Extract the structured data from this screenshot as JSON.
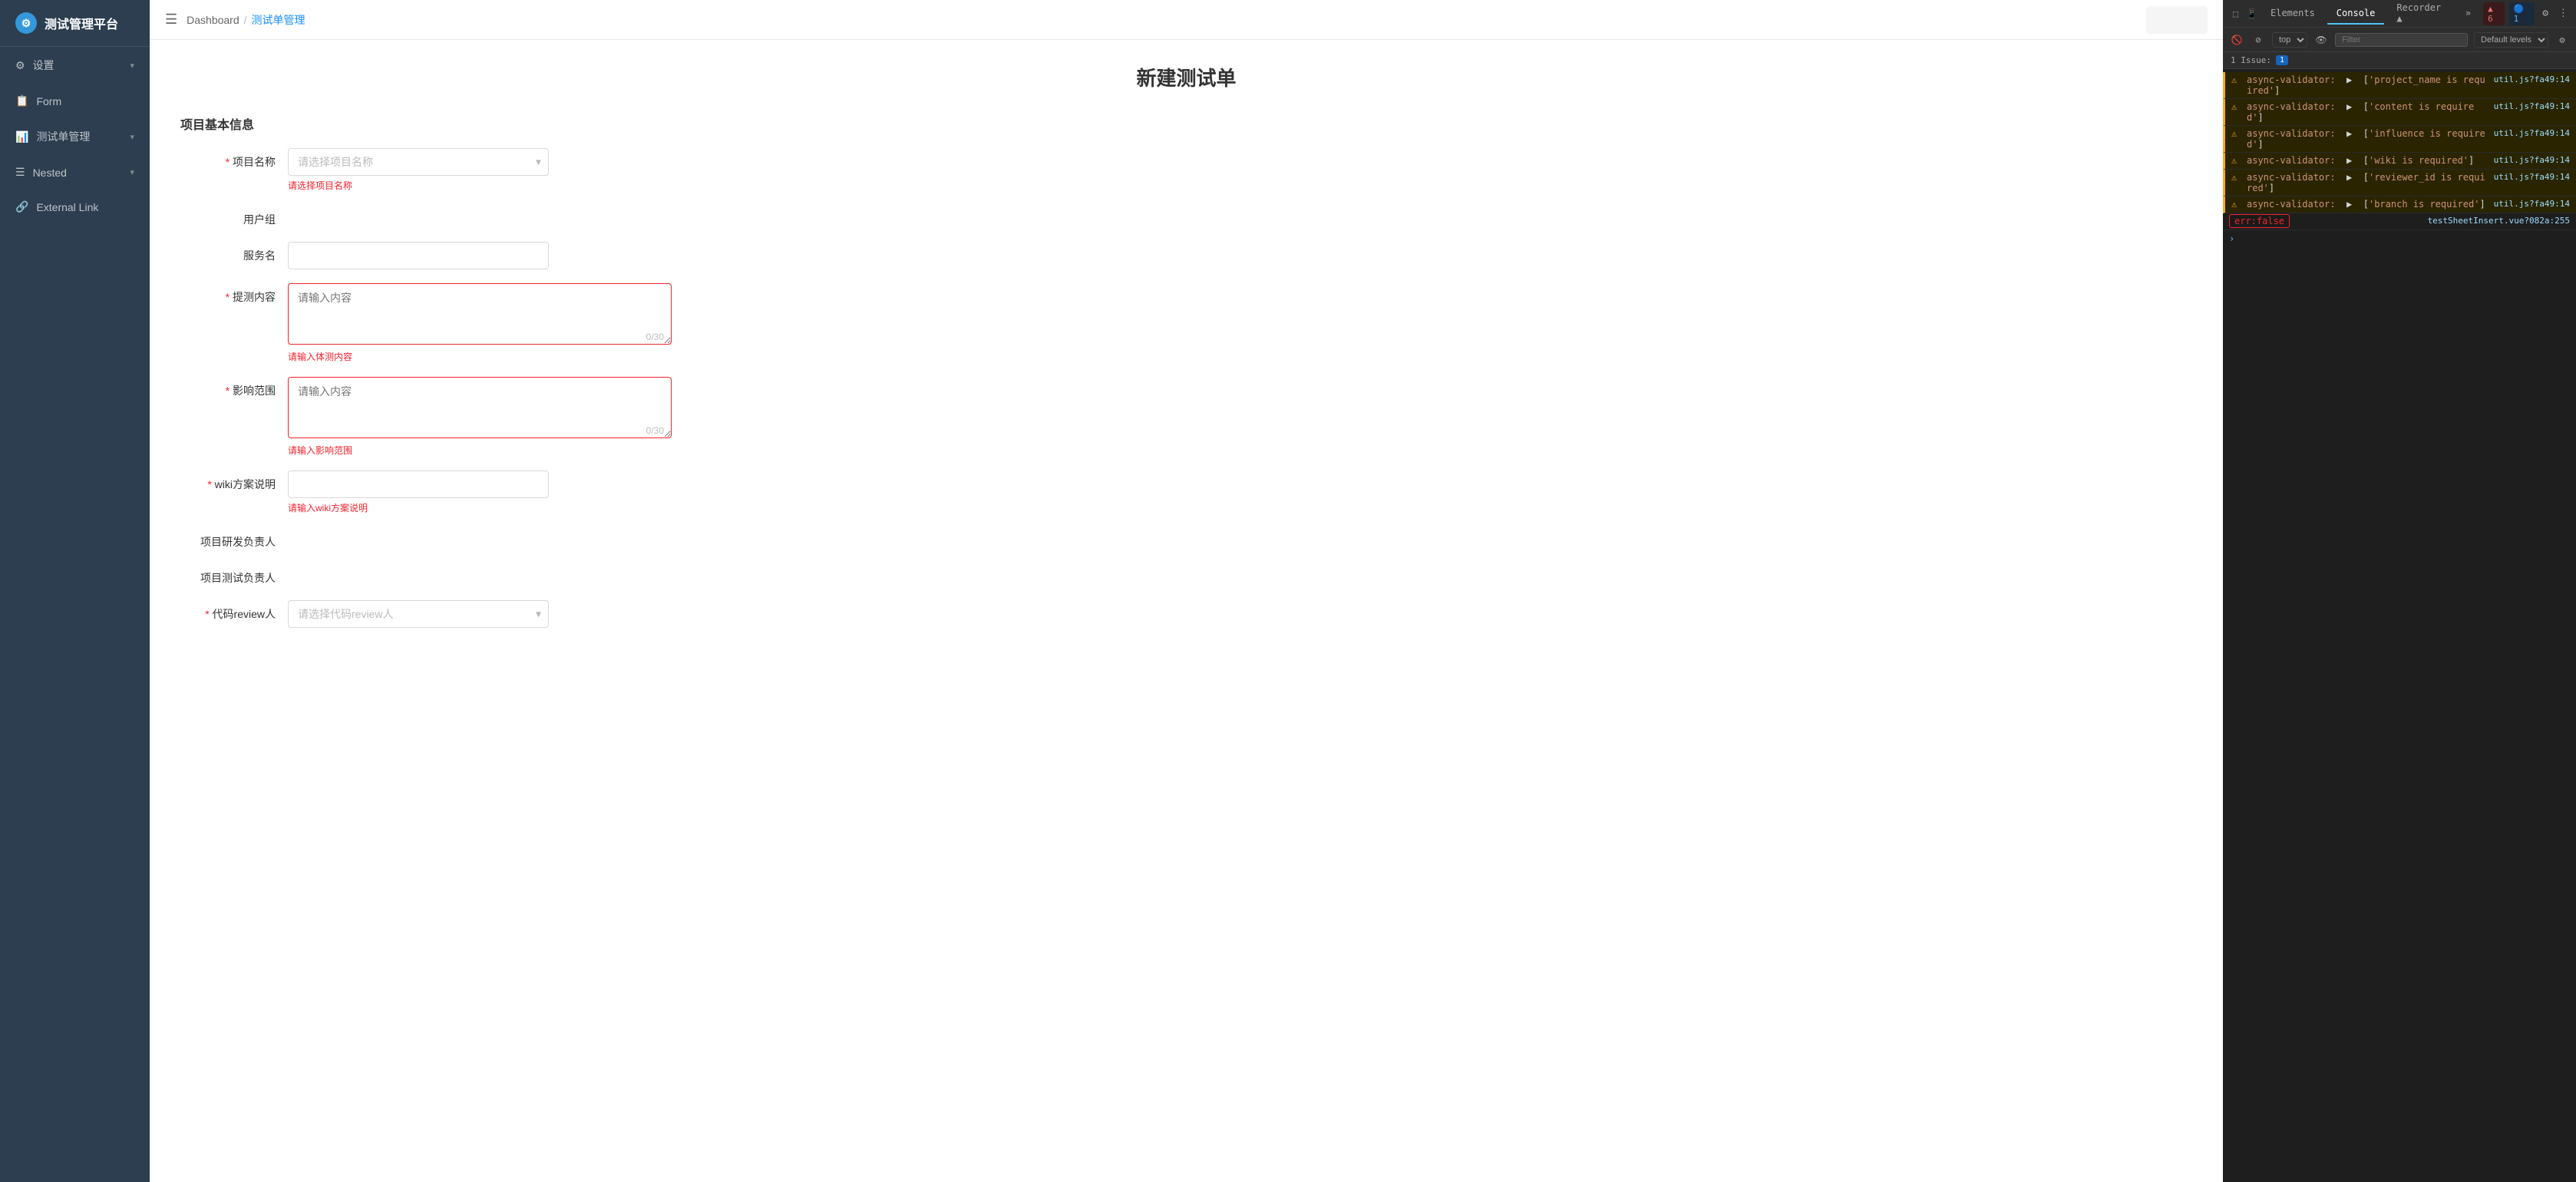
{
  "sidebar": {
    "logo": {
      "icon": "⚙",
      "title": "测试管理平台"
    },
    "items": [
      {
        "id": "settings",
        "icon": "⚙",
        "label": "设置",
        "hasChevron": true
      },
      {
        "id": "form",
        "icon": "📋",
        "label": "Form",
        "hasChevron": false
      },
      {
        "id": "test-manage",
        "icon": "📊",
        "label": "测试单管理",
        "hasChevron": true
      },
      {
        "id": "nested",
        "icon": "☰",
        "label": "Nested",
        "hasChevron": true
      },
      {
        "id": "external-link",
        "icon": "🔗",
        "label": "External Link",
        "hasChevron": false
      }
    ]
  },
  "topbar": {
    "breadcrumb": {
      "home": "Dashboard",
      "separator": "/",
      "current": "测试单管理"
    }
  },
  "form": {
    "page_title": "新建测试单",
    "section_title": "项目基本信息",
    "fields": {
      "project_name": {
        "label": "项目名称",
        "required": true,
        "placeholder": "请选择项目名称",
        "error": "请选择项目名称"
      },
      "user_group": {
        "label": "用户组",
        "required": false
      },
      "service_name": {
        "label": "服务名",
        "required": false,
        "value": ""
      },
      "content": {
        "label": "提测内容",
        "required": true,
        "placeholder": "请输入内容",
        "count": "0/30",
        "error": "请输入体测内容"
      },
      "influence": {
        "label": "影响范围",
        "required": true,
        "placeholder": "请输入内容",
        "count": "0/30",
        "error": "请输入影响范围"
      },
      "wiki": {
        "label": "wiki方案说明",
        "required": true,
        "value": "",
        "error": "请输入wiki方案说明"
      },
      "dev_owner": {
        "label": "项目研发负责人",
        "required": false
      },
      "test_owner": {
        "label": "项目测试负责人",
        "required": false
      },
      "reviewer": {
        "label": "代码review人",
        "required": true,
        "placeholder": "请选择代码review人"
      }
    }
  },
  "devtools": {
    "tabs": [
      "Elements",
      "Console",
      "Recorder ▲",
      "▸",
      "▲ 6",
      "🔵 1",
      "⚙",
      "⋮"
    ],
    "active_tab": "Console",
    "toolbar": {
      "top_label": "top",
      "filter_placeholder": "Filter",
      "levels_label": "Default levels"
    },
    "issues_bar": {
      "label": "1 Issue:",
      "count": "1"
    },
    "console_lines": [
      {
        "type": "warning",
        "text_parts": [
          {
            "type": "validator",
            "text": "async-validator:"
          },
          {
            "type": "space"
          },
          {
            "type": "arrow",
            "text": "▶"
          },
          {
            "type": "bracket",
            "text": "["
          },
          {
            "type": "string",
            "text": "'project_name is required'"
          },
          {
            "type": "bracket",
            "text": "]"
          }
        ],
        "file": "util.js?fa49:14"
      },
      {
        "type": "warning",
        "text_parts": [
          {
            "type": "validator",
            "text": "async-validator:"
          },
          {
            "type": "space"
          },
          {
            "type": "arrow",
            "text": "▶"
          },
          {
            "type": "bracket",
            "text": "["
          },
          {
            "type": "string",
            "text": "'content is required'"
          },
          {
            "type": "bracket",
            "text": "]"
          }
        ],
        "file": "util.js?fa49:14"
      },
      {
        "type": "warning",
        "text_parts": [
          {
            "type": "validator",
            "text": "async-validator:"
          },
          {
            "type": "space"
          },
          {
            "type": "arrow",
            "text": "▶"
          },
          {
            "type": "bracket",
            "text": "["
          },
          {
            "type": "string",
            "text": "'influence is required'"
          },
          {
            "type": "bracket",
            "text": "]"
          }
        ],
        "file": "util.js?fa49:14"
      },
      {
        "type": "warning",
        "text_parts": [
          {
            "type": "validator",
            "text": "async-validator:"
          },
          {
            "type": "space"
          },
          {
            "type": "arrow",
            "text": "▶"
          },
          {
            "type": "bracket",
            "text": "["
          },
          {
            "type": "string",
            "text": "'wiki is required'"
          },
          {
            "type": "bracket",
            "text": "]"
          }
        ],
        "file": "util.js?fa49:14"
      },
      {
        "type": "warning",
        "text_parts": [
          {
            "type": "validator",
            "text": "async-validator:"
          },
          {
            "type": "space"
          },
          {
            "type": "arrow",
            "text": "▶"
          },
          {
            "type": "bracket",
            "text": "["
          },
          {
            "type": "string",
            "text": "'reviewer_id is required'"
          },
          {
            "type": "bracket",
            "text": "]"
          }
        ],
        "file": "util.js?fa49:14"
      },
      {
        "type": "warning",
        "text_parts": [
          {
            "type": "validator",
            "text": "async-validator:"
          },
          {
            "type": "space"
          },
          {
            "type": "arrow",
            "text": "▶"
          },
          {
            "type": "bracket",
            "text": "["
          },
          {
            "type": "string",
            "text": "'branch is required'"
          },
          {
            "type": "bracket",
            "text": "]"
          }
        ],
        "file": "util.js?fa49:14"
      },
      {
        "type": "err-false",
        "badge": "err:false",
        "file": "testSheetInsert.vue?082a:255"
      }
    ],
    "prompt": ">"
  }
}
